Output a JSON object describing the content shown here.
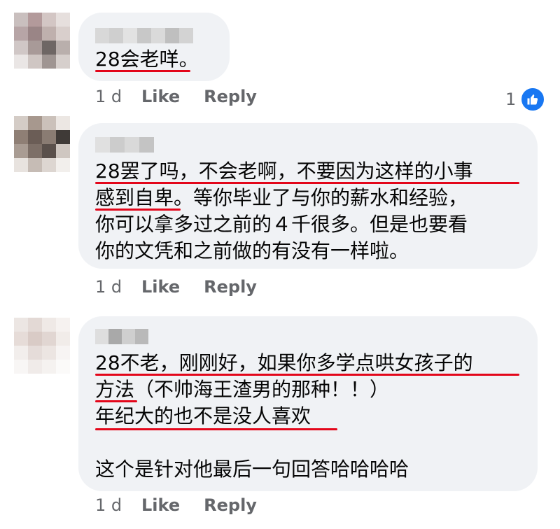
{
  "comments": [
    {
      "lines": [
        "28会老咩。"
      ],
      "time": "1 d",
      "like": "Like",
      "reply": "Reply",
      "reaction_count": "1"
    },
    {
      "lines": [
        "28罢了吗，不会老啊，不要因为这样的小事",
        "感到自卑。等你毕业了与你的薪水和经验，",
        "你可以拿多过之前的４千很多。但是也要看",
        "你的文凭和之前做的有没有一样啦。"
      ],
      "time": "1 d",
      "like": "Like",
      "reply": "Reply"
    },
    {
      "lines": [
        "28不老，刚刚好，如果你多学点哄女孩子的",
        "方法（不帅海王渣男的那种！！）",
        "年纪大的也不是没人喜欢",
        "",
        "这个是针对他最后一句回答哈哈哈哈"
      ],
      "time": "1 d",
      "like": "Like",
      "reply": "Reply"
    }
  ],
  "colors": {
    "bubble": "#f0f2f5",
    "underline": "#e3061a",
    "meta": "#65676b",
    "like_icon": "#1877f2"
  },
  "icons": {
    "reaction": "thumbs-up-icon"
  }
}
